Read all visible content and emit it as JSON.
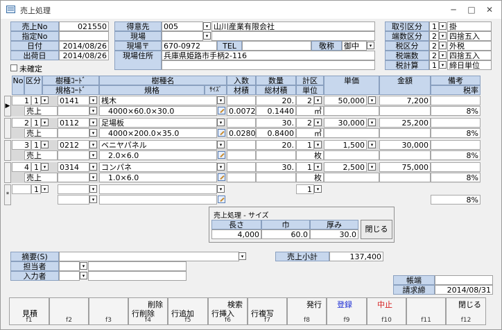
{
  "window": {
    "title": "売上処理",
    "min": "─",
    "max": "□",
    "close": "✕"
  },
  "header": {
    "sales_no_label": "売上No",
    "sales_no": "021550",
    "spec_no_label": "指定No",
    "spec_no": "",
    "date_label": "日付",
    "date": "2014/08/26",
    "ship_label": "出荷日",
    "ship_date": "2014/08/26",
    "unconfirmed": "未確定",
    "customer_label": "得意先",
    "customer_code": "005",
    "customer_name": "山川産業有限会社",
    "site_label": "現場",
    "site": "",
    "zip_label": "現場〒",
    "zip": "670-0972",
    "tel_label": "TEL",
    "tel": "",
    "honor_label": "敬称",
    "honor": "御中",
    "addr_label": "現場住所",
    "addr": "兵庫県姫路市手柄2-116",
    "right": [
      {
        "label": "取引区分",
        "code": "1",
        "text": "掛"
      },
      {
        "label": "端数区分",
        "code": "2",
        "text": "四捨五入"
      },
      {
        "label": "税区分",
        "code": "2",
        "text": "外税"
      },
      {
        "label": "税端数",
        "code": "2",
        "text": "四捨五入"
      },
      {
        "label": "税計算",
        "code": "1",
        "text": "締日単位"
      }
    ]
  },
  "grid": {
    "h": {
      "no": "No",
      "kubun": "区分",
      "code": "樹種ｺｰﾄﾞ",
      "kcode": "規格ｺｰﾄﾞ",
      "name": "樹種名",
      "spec": "規格",
      "size": "ｻｲｽﾞ",
      "qty": "入数",
      "vol": "材積",
      "amount": "数量",
      "tvol": "総材積",
      "calc": "計区",
      "unit": "単位",
      "price": "単価",
      "total": "金額",
      "note": "備考",
      "tax": "税率"
    },
    "rows": [
      {
        "no": "1",
        "kubun": "1",
        "sale": "売上",
        "code": "0141",
        "name": "桟木",
        "spec": "4000×60.0×30.0",
        "qty": "",
        "vol": "0.0072",
        "amount": "20.",
        "tvol": "0.1440",
        "calc": "2",
        "unit": "㎥",
        "price": "50,000",
        "total": "7,200",
        "tax": "8%"
      },
      {
        "no": "2",
        "kubun": "1",
        "sale": "売上",
        "code": "0112",
        "name": "足場板",
        "spec": "4000×200.0×35.0",
        "qty": "",
        "vol": "0.0280",
        "amount": "30.",
        "tvol": "0.8400",
        "calc": "2",
        "unit": "㎥",
        "price": "30,000",
        "total": "25,200",
        "tax": "8%"
      },
      {
        "no": "3",
        "kubun": "1",
        "sale": "売上",
        "code": "0212",
        "name": "ベニヤパネル",
        "spec": "2.0×6.0",
        "qty": "",
        "vol": "",
        "amount": "20.",
        "tvol": "",
        "calc": "1",
        "unit": "枚",
        "price": "1,500",
        "total": "30,000",
        "tax": "8%"
      },
      {
        "no": "4",
        "kubun": "1",
        "sale": "売上",
        "code": "0314",
        "name": "コンパネ",
        "spec": "1.0×6.0",
        "qty": "",
        "vol": "",
        "amount": "30.",
        "tvol": "",
        "calc": "1",
        "unit": "枚",
        "price": "2,500",
        "total": "75,000",
        "tax": "8%"
      }
    ],
    "new_row": {
      "marker": "*",
      "kubun": "1",
      "calc": "1",
      "tax": "8%"
    }
  },
  "popup": {
    "title": "売上処理 - サイズ",
    "length_label": "長さ",
    "width_label": "巾",
    "thick_label": "厚み",
    "length": "4,000",
    "width": "60.0",
    "thick": "30.0",
    "close": "閉じる"
  },
  "footer": {
    "memo_label": "摘要(S)",
    "memo": "",
    "staff_label": "担当者",
    "input_label": "入力者",
    "subtotal_label": "売上小計",
    "subtotal": "137,400",
    "ledger_label": "帳端",
    "ledger": "",
    "billing_label": "請求締",
    "billing": "2014/08/31"
  },
  "fkeys": [
    {
      "t1": "",
      "t2": "見積",
      "key": "f1"
    },
    {
      "t1": "",
      "t2": "",
      "key": "f2"
    },
    {
      "t1": "",
      "t2": "",
      "key": "f3"
    },
    {
      "t1": "削除",
      "t2": "行削除",
      "key": "f4"
    },
    {
      "t1": "",
      "t2": "行追加",
      "key": "f5"
    },
    {
      "t1": "検索",
      "t2": "行挿入",
      "key": "f6"
    },
    {
      "t1": "",
      "t2": "行複写",
      "key": "f7"
    },
    {
      "t1": "発行",
      "t2": "",
      "key": "f8"
    },
    {
      "t1": "登録",
      "t2": "",
      "key": "f9"
    },
    {
      "t1": "中止",
      "t2": "",
      "key": "f10"
    },
    {
      "t1": "",
      "t2": "",
      "key": "f11"
    },
    {
      "t1": "閉じる",
      "t2": "",
      "key": "f12"
    }
  ],
  "colors": {
    "label_bg": "#c7d7ed",
    "register": "#1a2bd4",
    "cancel": "#d41a1a"
  },
  "icons": {
    "dropdown": "▾",
    "row_selector": "▶"
  }
}
